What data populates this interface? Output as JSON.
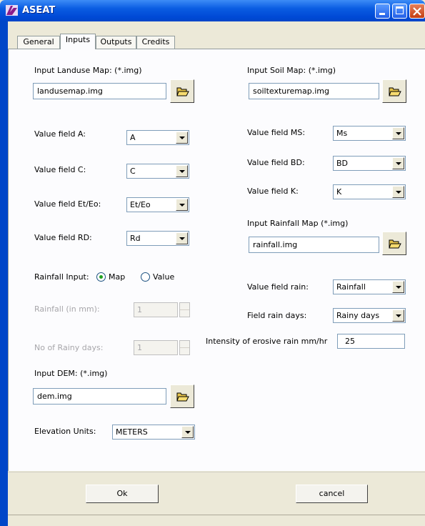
{
  "window": {
    "title": "ASEAT"
  },
  "tabs": [
    {
      "label": "General"
    },
    {
      "label": "Inputs"
    },
    {
      "label": "Outputs"
    },
    {
      "label": "Credits"
    }
  ],
  "landuse": {
    "label": "Input Landuse Map: (*.img)",
    "value": "landusemap.img",
    "fields": [
      {
        "label": "Value field A:",
        "value": "A"
      },
      {
        "label": "Value field C:",
        "value": "C"
      },
      {
        "label": "Value field Et/Eo:",
        "value": "Et/Eo"
      },
      {
        "label": "Value field RD:",
        "value": "Rd"
      }
    ]
  },
  "soil": {
    "label": "Input Soil Map: (*.img)",
    "value": "soiltexturemap.img",
    "fields": [
      {
        "label": "Value field MS:",
        "value": "Ms"
      },
      {
        "label": "Value field BD:",
        "value": "BD"
      },
      {
        "label": "Value field K:",
        "value": "K"
      }
    ]
  },
  "rainfall_map": {
    "label": "Input Rainfall Map (*.img)",
    "value": "rainfall.img",
    "field_rain_label": "Value field rain:",
    "field_rain_value": "Rainfall",
    "rain_days_label": "Field rain days:",
    "rain_days_value": "Rainy days",
    "intensity_label": "Intensity of erosive rain mm/hr",
    "intensity_value": "25"
  },
  "rainfall_input": {
    "label": "Rainfall Input:",
    "option_map": "Map",
    "option_value": "Value",
    "selected": "Map",
    "rainfall_label": "Rainfall  (in mm):",
    "rainfall_value": "1",
    "rainy_days_label": "No of Rainy days:",
    "rainy_days_value": "1"
  },
  "dem": {
    "label": "Input DEM: (*.img)",
    "value": "dem.img",
    "units_label": "Elevation Units:",
    "units_value": "METERS"
  },
  "buttons": {
    "ok": "Ok",
    "cancel": "cancel"
  },
  "colors": {
    "titlebar": "#0a5ce2",
    "dialog_bg": "#ece9d8",
    "panel_bg": "#fcfcfe"
  }
}
